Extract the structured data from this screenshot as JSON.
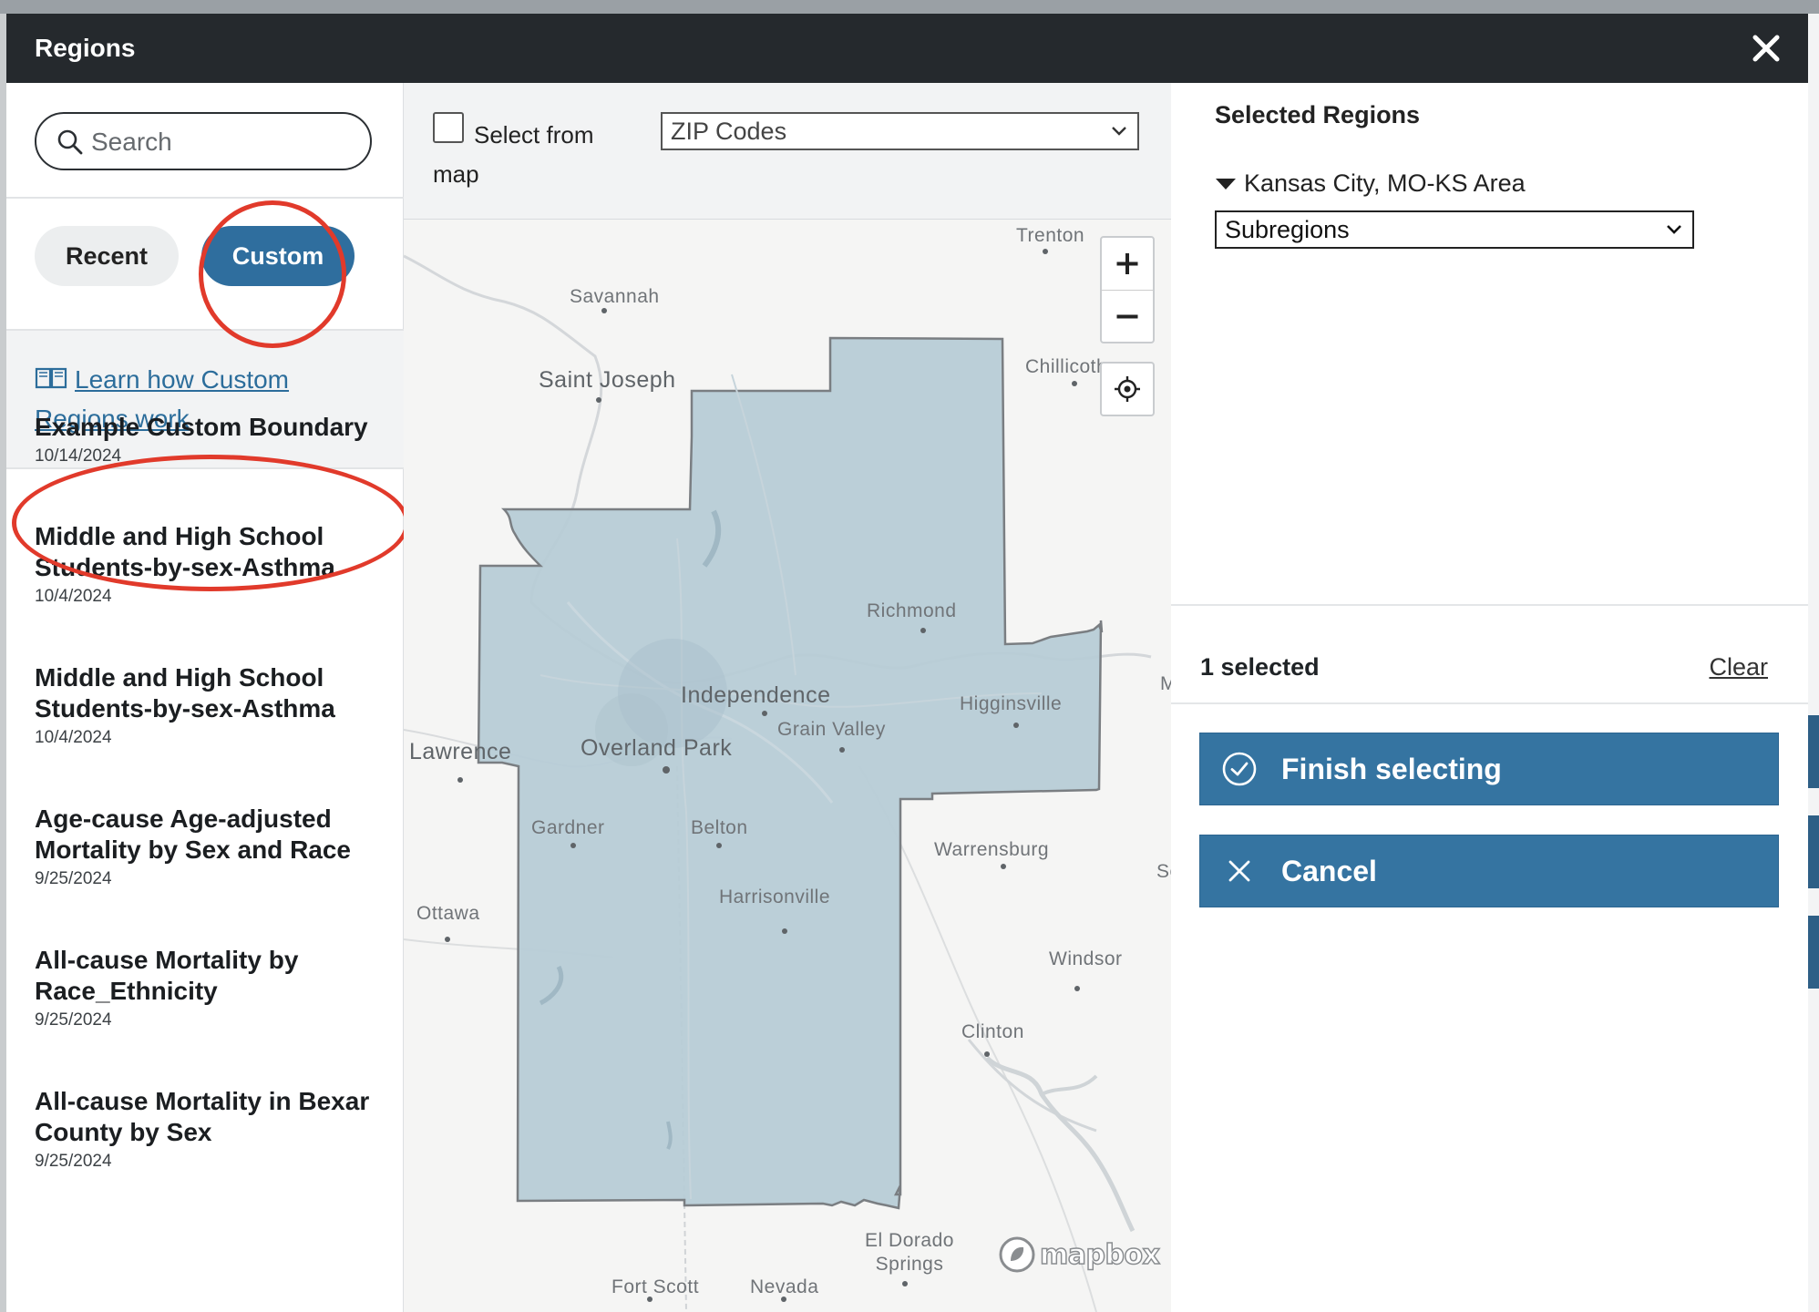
{
  "modal": {
    "title": "Regions"
  },
  "left": {
    "search_placeholder": "Search",
    "tabs": {
      "recent": "Recent",
      "custom": "Custom"
    },
    "learn_link": "Learn how Custom Regions work",
    "boundaries": [
      {
        "name": "Example Custom Boundary",
        "date": "10/14/2024"
      },
      {
        "name": "Middle and High School Students-by-sex-Asthma",
        "date": "10/4/2024"
      },
      {
        "name": "Middle and High School Students-by-sex-Asthma",
        "date": "10/4/2024"
      },
      {
        "name": "Age-cause Age-adjusted Mortality by Sex and Race",
        "date": "9/25/2024"
      },
      {
        "name": "All-cause Mortality by Race_Ethnicity",
        "date": "9/25/2024"
      },
      {
        "name": "All-cause Mortality in Bexar County by Sex",
        "date": "9/25/2024"
      }
    ]
  },
  "map": {
    "select_from_map_label": "Select from map",
    "geography_select": "ZIP Codes",
    "labels": {
      "trenton": "Trenton",
      "savannah": "Savannah",
      "saint_joseph": "Saint Joseph",
      "chillicothe": "Chillicothe",
      "richmond": "Richmond",
      "independence": "Independence",
      "higginsville": "Higginsville",
      "grain_valley": "Grain Valley",
      "lawrence": "Lawrence",
      "overland_park": "Overland Park",
      "gardner": "Gardner",
      "belton": "Belton",
      "warrensburg": "Warrensburg",
      "harrisonville": "Harrisonville",
      "ottawa": "Ottawa",
      "windsor": "Windsor",
      "clinton": "Clinton",
      "el_dorado_springs": "El Dorado Springs",
      "fort_scott": "Fort Scott",
      "nevada": "Nevada",
      "edge_m": "M",
      "edge_se": "Se"
    },
    "attribution": "mapbox",
    "region_fill_color": "#b7ccd6"
  },
  "right": {
    "title": "Selected Regions",
    "region_name": "Kansas City, MO-KS Area",
    "subregions_select": "Subregions",
    "selected_count": "1 selected",
    "clear": "Clear",
    "finish_button": "Finish selecting",
    "cancel_button": "Cancel",
    "accent_color": "#3574a1"
  }
}
